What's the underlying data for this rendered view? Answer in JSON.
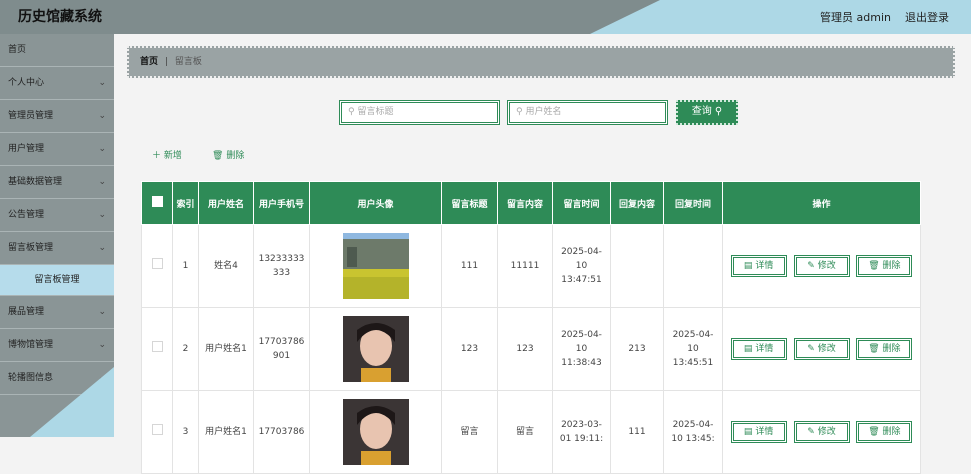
{
  "header": {
    "app_title": "历史馆藏系统",
    "admin_label": "管理员 admin",
    "logout_label": "退出登录"
  },
  "sidebar": {
    "items": [
      {
        "label": "首页",
        "has_chevron": false
      },
      {
        "label": "个人中心",
        "has_chevron": true
      },
      {
        "label": "管理员管理",
        "has_chevron": true
      },
      {
        "label": "用户管理",
        "has_chevron": true
      },
      {
        "label": "基础数据管理",
        "has_chevron": true
      },
      {
        "label": "公告管理",
        "has_chevron": true
      },
      {
        "label": "留言板管理",
        "has_chevron": true
      }
    ],
    "active_sub": "留言板管理",
    "items_after": [
      {
        "label": "展品管理",
        "has_chevron": true
      },
      {
        "label": "博物馆管理",
        "has_chevron": true
      },
      {
        "label": "轮播图信息",
        "has_chevron": true
      }
    ]
  },
  "breadcrumb": {
    "home": "首页",
    "separator": "|",
    "current": "留言板"
  },
  "search": {
    "title_placeholder": "留言标题",
    "name_placeholder": "用户姓名",
    "query_label": "查询"
  },
  "actions": {
    "add_label": "新增",
    "delete_label": "删除"
  },
  "table": {
    "headers": [
      "索引",
      "用户姓名",
      "用户手机号",
      "用户头像",
      "留言标题",
      "留言内容",
      "留言时间",
      "回复内容",
      "回复时间",
      "操作"
    ],
    "rows": [
      {
        "index": "1",
        "name": "姓名4",
        "phone": "13233333333",
        "avatar": "landscape",
        "title": "111",
        "content": "11111",
        "time": "2025-04-10 13:47:51",
        "reply": "",
        "reply_time": ""
      },
      {
        "index": "2",
        "name": "用户姓名1",
        "phone": "17703786901",
        "avatar": "portrait",
        "title": "123",
        "content": "123",
        "time": "2025-04-10 11:38:43",
        "reply": "213",
        "reply_time": "2025-04-10 13:45:51"
      },
      {
        "index": "3",
        "name": "用户姓名1",
        "phone": "17703786",
        "avatar": "portrait",
        "title": "留言",
        "content": "留言",
        "time": "2023-03-01 19:11:",
        "reply": "111",
        "reply_time": "2025-04-10 13:45:"
      }
    ],
    "op_labels": {
      "detail": "详情",
      "edit": "修改",
      "delete": "删除"
    }
  },
  "colors": {
    "primary": "#2e8b57",
    "header_bg": "#7f8c8d",
    "accent_light_blue": "#b6dceb",
    "sidebar_bg": "#8a9596"
  }
}
